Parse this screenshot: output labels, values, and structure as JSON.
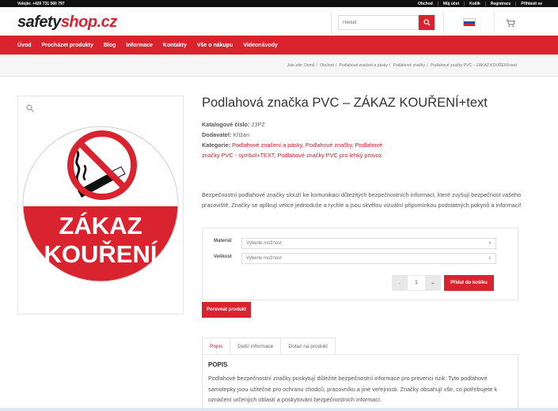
{
  "topbar": {
    "phone": "Volejte: +420 731 560 797",
    "links": [
      "Obchod",
      "Můj účet",
      "Košík",
      "Registrace",
      "Přihlásit se"
    ]
  },
  "header": {
    "logo_part1": "safety",
    "logo_part2": "shop.cz",
    "search_placeholder": "Hledat"
  },
  "nav": {
    "items": [
      "Úvod",
      "Procházet produkty",
      "Blog",
      "Informace",
      "Kontakty",
      "Vše o nákupu",
      "Videonávody"
    ]
  },
  "breadcrumb": {
    "prefix": "Jste zde:",
    "items": [
      "Domů",
      "Obchod",
      "Podlahové značení a pásky",
      "Podlahové značky",
      "Podlahové značky PVC – ZÁKAZ KOUŘENÍ+text"
    ]
  },
  "product": {
    "sign_line1": "ZÁKAZ",
    "sign_line2": "KOUŘENÍ",
    "title": "Podlahová značka PVC – ZÁKAZ KOUŘENÍ+text",
    "catalog_label": "Katalogové číslo:",
    "catalog_value": "23PZ",
    "supplier_label": "Dodavatel:",
    "supplier_value": "Křižan",
    "category_label": "Kategorie:",
    "categories": [
      "Podlahové značení a pásky",
      "Podlahové značky",
      "Podlahové značky PVC - symbol+TEXT",
      "Podlahové značky PVC pro lehký provoz"
    ],
    "description": "Bezpečnostní podlahové značky slouží ke komunikaci důležitých bezpečnostních informací, které zvyšují bezpečnost vašeho pracoviště. Značky se aplikují velice jednoduše a rychle a jsou skvělou vizuální připomínkou podstatných pokynů a informací!",
    "material_label": "Materiál",
    "material_value": "Vyberte možnost",
    "size_label": "Velikost",
    "size_value": "Vyberte možnost",
    "qty_minus": "-",
    "qty_value": "1",
    "qty_plus": "+",
    "add_to_cart": "Přidat do košíku",
    "compare": "Porovnat produkt"
  },
  "tabs": {
    "items": [
      "Popis",
      "Další informace",
      "Dotaz na produkt"
    ],
    "panel_title": "POPIS",
    "panel_text": "Podlahové bezpečnostní značky poskytují důležité bezpečnostní informace pro prevenci rizik. Tyto podlahové samolepky jsou užitečné pro ochranu chodců, pracovníku a jiné veřejnosti. Značky obsahují vše, co potřebujete k označení určených oblastí a poskytování bezpečnostních informací."
  },
  "colors": {
    "brand_red": "#d9232e",
    "topbar_bg": "#111111"
  }
}
